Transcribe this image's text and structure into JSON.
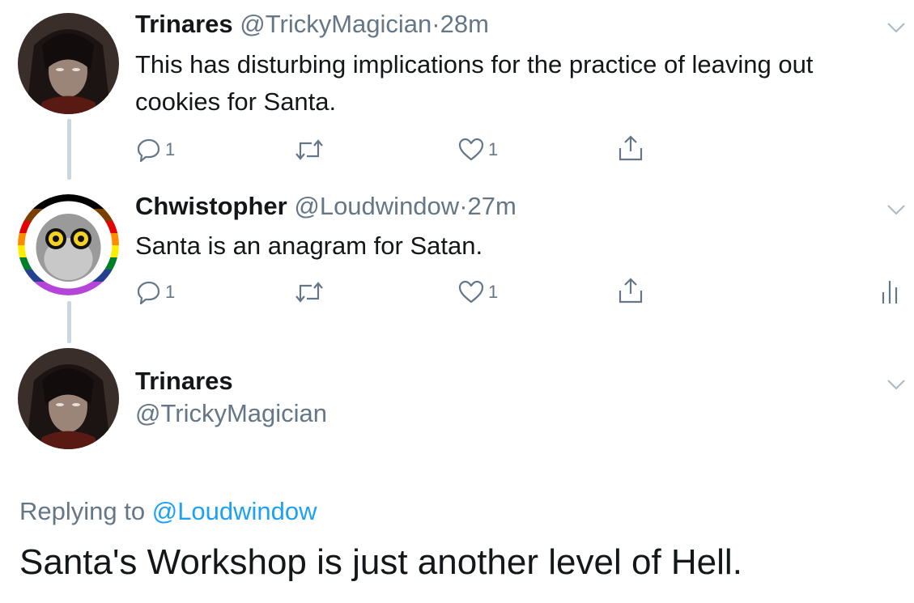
{
  "tweets": [
    {
      "name": "Trinares",
      "handle": "@TrickyMagician",
      "separator": "·",
      "time": "28m",
      "text": "This has disturbing implications for the practice of leaving out cookies for Santa.",
      "reply_count": "1",
      "like_count": "1"
    },
    {
      "name": "Chwistopher",
      "handle": "@Loudwindow",
      "separator": "·",
      "time": "27m",
      "text": "Santa is an anagram for Satan.",
      "reply_count": "1",
      "like_count": "1"
    }
  ],
  "focused_tweet": {
    "name": "Trinares",
    "handle": "@TrickyMagician",
    "replying_prefix": "Replying to",
    "replying_to": "@Loudwindow",
    "text": "Santa's Workshop is just another level of Hell."
  },
  "icons": {
    "reply": "reply-icon",
    "retweet": "retweet-icon",
    "like": "heart-icon",
    "share": "share-icon",
    "analytics": "analytics-icon",
    "menu": "chevron-down-icon"
  },
  "colors": {
    "text": "#14171a",
    "secondary": "#657786",
    "link": "#1da1f2",
    "thread_line": "#ccd6dd"
  }
}
